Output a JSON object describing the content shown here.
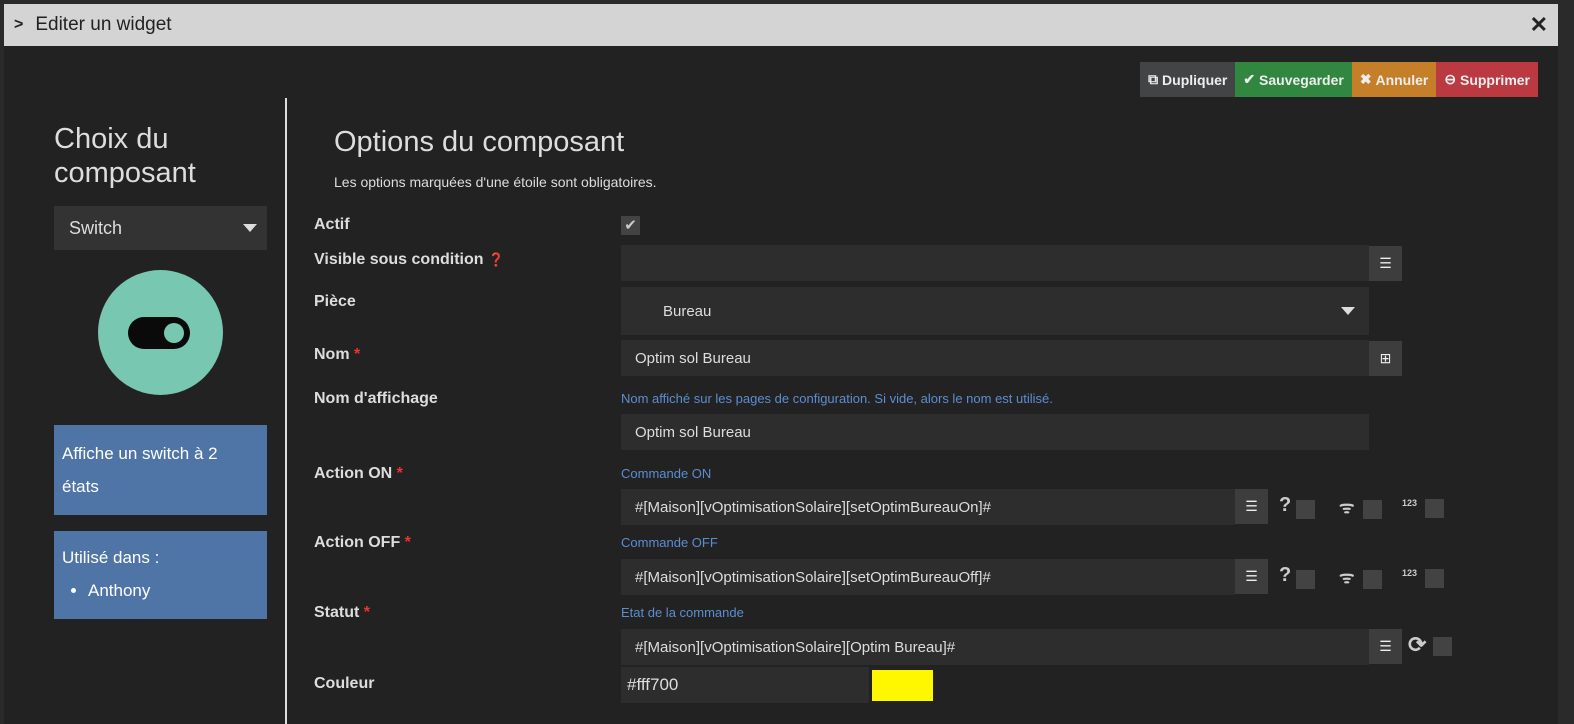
{
  "title": "Editer un widget",
  "toolbar": {
    "duplicate": "Dupliquer",
    "save": "Sauvegarder",
    "cancel": "Annuler",
    "delete": "Supprimer"
  },
  "left": {
    "heading": "Choix du composant",
    "component": "Switch",
    "description": "Affiche un switch à 2 états",
    "used_in_label": "Utilisé dans :",
    "used_in": [
      "Anthony"
    ]
  },
  "main": {
    "title": "Options du composant",
    "subtitle": "Les options marquées d'une étoile sont obligatoires.",
    "actif": "Actif",
    "visible": "Visible sous condition",
    "piece": "Pièce",
    "piece_value": "Bureau",
    "nom": "Nom",
    "nom_value": "Optim sol Bureau",
    "nom_affichage": "Nom d'affichage",
    "nom_affichage_hint": "Nom affiché sur les pages de configuration. Si vide, alors le nom est utilisé.",
    "nom_affichage_value": "Optim sol Bureau",
    "action_on": "Action ON",
    "action_on_hint": "Commande ON",
    "action_on_value": "#[Maison][vOptimisationSolaire][setOptimBureauOn]#",
    "action_off": "Action OFF",
    "action_off_hint": "Commande OFF",
    "action_off_value": "#[Maison][vOptimisationSolaire][setOptimBureauOff]#",
    "statut": "Statut",
    "statut_hint": "Etat de la commande",
    "statut_value": "#[Maison][vOptimisationSolaire][Optim Bureau]#",
    "couleur": "Couleur",
    "couleur_value": "#fff700",
    "required_mark": "*",
    "numeric_icon": "123"
  },
  "colors": {
    "swatch": "#fff700"
  }
}
